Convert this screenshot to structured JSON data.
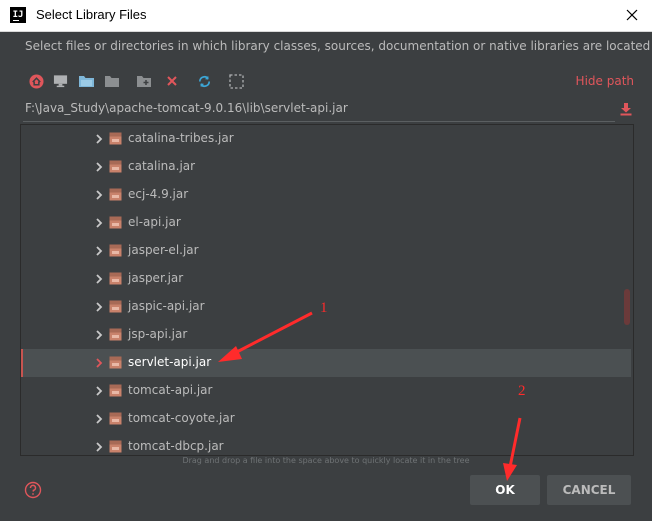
{
  "window": {
    "title": "Select Library Files",
    "app_icon_text": "IJ"
  },
  "description": "Select files or directories in which library classes, sources, documentation or native libraries are located",
  "toolbar": {
    "icons": [
      "home-icon",
      "desktop-icon",
      "project-folder-icon",
      "module-folder-icon",
      "new-folder-icon",
      "delete-icon",
      "refresh-icon",
      "show-hidden-icon"
    ],
    "hide_path_label": "Hide path"
  },
  "path": {
    "value": "F:\\Java_Study\\apache-tomcat-9.0.16\\lib\\servlet-api.jar"
  },
  "tree": {
    "items": [
      {
        "label": "catalina-tribes.jar"
      },
      {
        "label": "catalina.jar"
      },
      {
        "label": "ecj-4.9.jar"
      },
      {
        "label": "el-api.jar"
      },
      {
        "label": "jasper-el.jar"
      },
      {
        "label": "jasper.jar"
      },
      {
        "label": "jaspic-api.jar"
      },
      {
        "label": "jsp-api.jar"
      },
      {
        "label": "servlet-api.jar",
        "selected": true
      },
      {
        "label": "tomcat-api.jar"
      },
      {
        "label": "tomcat-coyote.jar"
      },
      {
        "label": "tomcat-dbcp.jar"
      }
    ]
  },
  "drag_hint": "Drag and drop a file into the space above to quickly locate it in the tree",
  "buttons": {
    "ok": "OK",
    "cancel": "CANCEL"
  },
  "annotations": {
    "first": "1",
    "second": "2"
  },
  "colors": {
    "accent": "#e0565b",
    "annotation": "#ff2b2b",
    "background": "#3c3f41",
    "selection": "#4b5052"
  }
}
